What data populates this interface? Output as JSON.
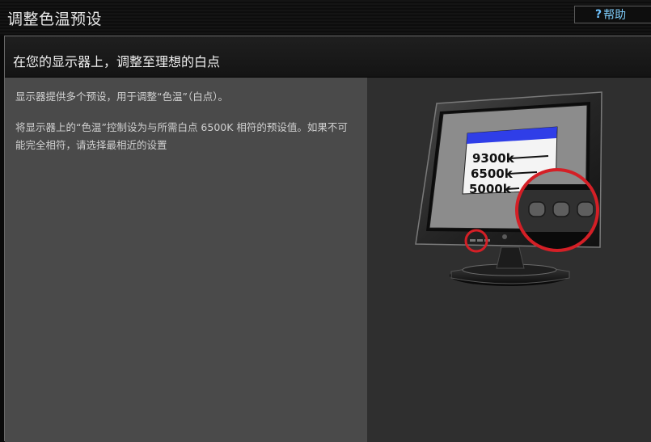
{
  "window": {
    "title": "调整色温预设",
    "help": {
      "icon": "question-icon",
      "icon_glyph": "?",
      "label": "帮助"
    }
  },
  "panel": {
    "title": "在您的显示器上，调整至理想的白点",
    "description": [
      "显示器提供多个预设，用于调整“色温”（白点）。",
      "将显示器上的“色温”控制设为与所需白点 6500K 相符的预设值。如果不可能完全相符，请选择最相近的设置"
    ]
  },
  "illustration": {
    "menu_items": [
      "9300k",
      "6500k",
      "5000k"
    ],
    "colors": {
      "menu_header": "#2f3ee8",
      "highlight_ring": "#d41f26",
      "screen": "#8c8c8c"
    }
  }
}
